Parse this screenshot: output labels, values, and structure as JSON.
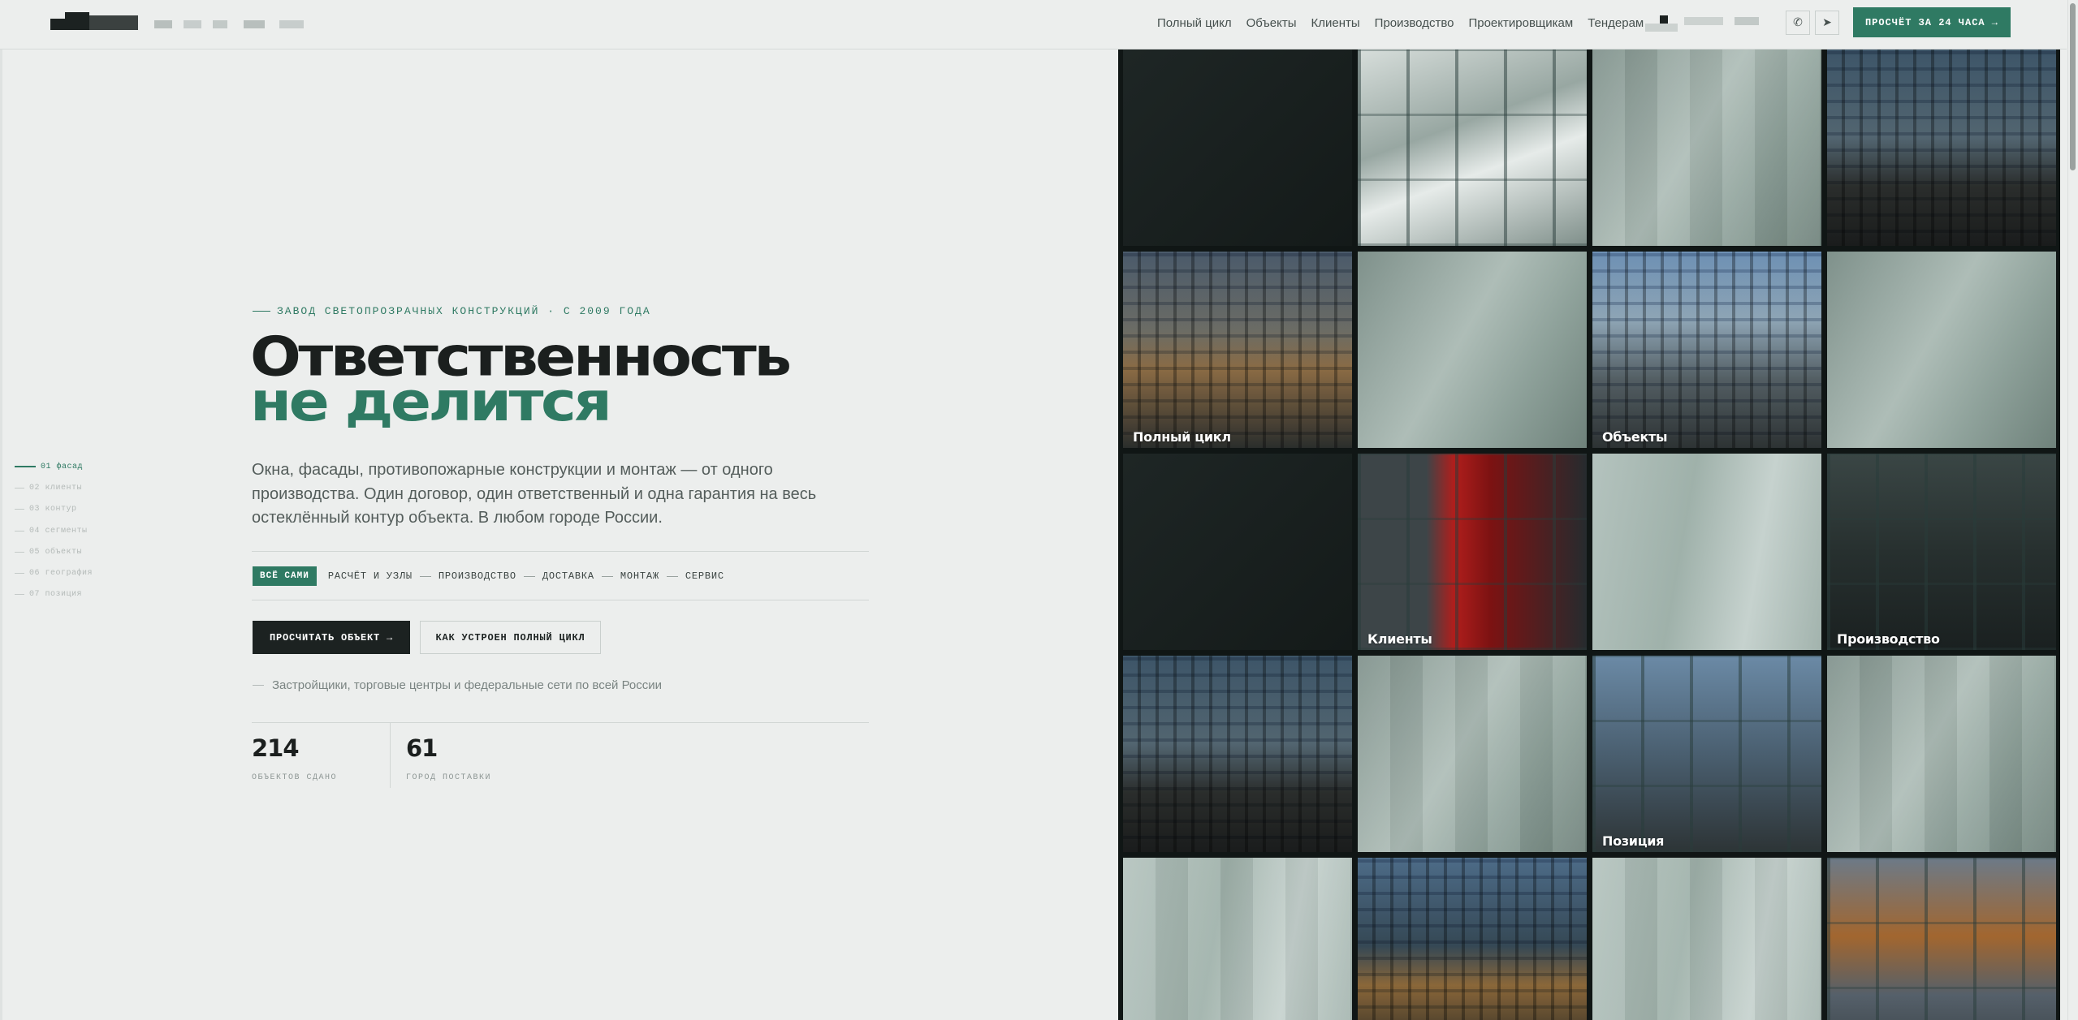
{
  "header": {
    "nav": [
      {
        "label": "Полный цикл"
      },
      {
        "label": "Объекты"
      },
      {
        "label": "Клиенты"
      },
      {
        "label": "Производство"
      },
      {
        "label": "Проектировщикам"
      },
      {
        "label": "Тендерам"
      }
    ],
    "cta_label": "ПРОСЧЁТ ЗА 24 ЧАСА →",
    "whatsapp_icon": "whatsapp-icon",
    "telegram_icon": "telegram-icon"
  },
  "side_index": [
    {
      "label": "01 фасад",
      "active": true
    },
    {
      "label": "02 клиенты"
    },
    {
      "label": "03 контур"
    },
    {
      "label": "04 сегменты"
    },
    {
      "label": "05 объекты"
    },
    {
      "label": "06 география"
    },
    {
      "label": "07 позиция"
    }
  ],
  "hero": {
    "eyebrow": "ЗАВОД СВЕТОПРОЗРАЧНЫХ КОНСТРУКЦИЙ · С 2009 ГОДА",
    "title_line1": "Ответственность",
    "title_line2": "не делится",
    "lead": "Окна, фасады, противопожарные конструкции и монтаж — от одного производства. Один договор, один ответственный и одна гарантия на весь остеклённый контур объекта. В любом городе России.",
    "chip_main": "ВСЁ САМИ",
    "chips": [
      "РАСЧЁТ И УЗЛЫ",
      "ПРОИЗВОДСТВО",
      "ДОСТАВКА",
      "МОНТАЖ",
      "СЕРВИС"
    ],
    "btn_primary": "ПРОСЧИТАТЬ ОБЪЕКТ →",
    "btn_secondary": "КАК УСТРОЕН ПОЛНЫЙ ЦИКЛ",
    "note": "Застройщики, торговые центры и федеральные сети по всей России"
  },
  "stats": [
    {
      "value": "214",
      "label": "ОБЪЕКТОВ СДАНО"
    },
    {
      "value": "61",
      "label": "ГОРОД ПОСТАВКИ"
    }
  ],
  "grid_labels": {
    "full_cycle": "Полный цикл",
    "objects": "Объекты",
    "clients": "Клиенты",
    "production": "Производство",
    "position": "Позиция"
  }
}
